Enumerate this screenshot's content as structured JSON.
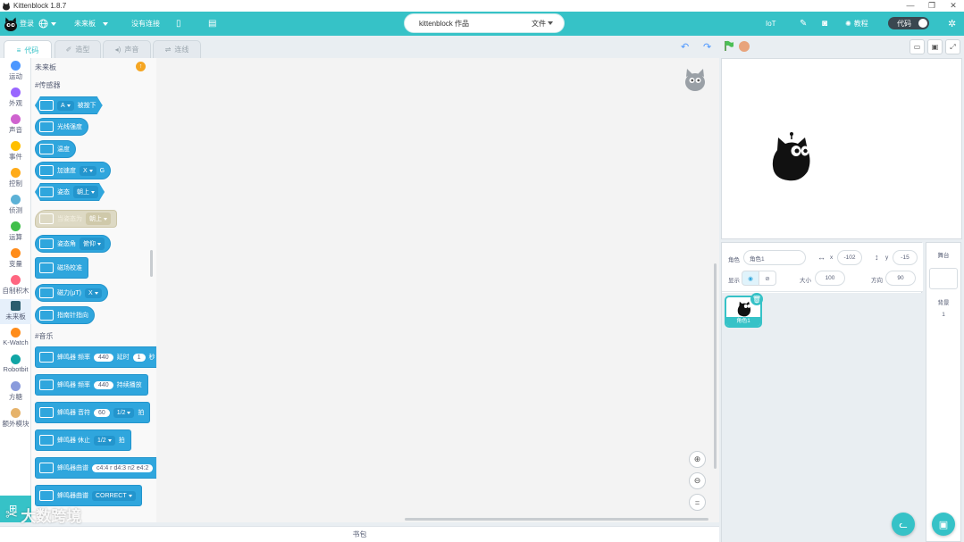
{
  "window": {
    "title": "Kittenblock 1.8.7",
    "controls": [
      "—",
      "❐",
      "✕"
    ]
  },
  "menubar": {
    "login": "登录",
    "board": "未来板",
    "device_status": "没有连接",
    "project_name": "kittenblock 作品",
    "file_menu": "文件",
    "iot": "IoT",
    "tutorial": "教程",
    "code_toggle": "代码"
  },
  "tabs": [
    {
      "label": "代码",
      "active": true
    },
    {
      "label": "造型",
      "active": false
    },
    {
      "label": "声音",
      "active": false
    },
    {
      "label": "连线",
      "active": false
    }
  ],
  "categories": [
    {
      "label": "运动",
      "color": "#4c97ff"
    },
    {
      "label": "外观",
      "color": "#9966ff"
    },
    {
      "label": "声音",
      "color": "#cf63cf"
    },
    {
      "label": "事件",
      "color": "#ffbf00"
    },
    {
      "label": "控制",
      "color": "#ffab19"
    },
    {
      "label": "侦测",
      "color": "#5cb1d6"
    },
    {
      "label": "运算",
      "color": "#40bf4a"
    },
    {
      "label": "变量",
      "color": "#ff8c1a"
    },
    {
      "label": "自制积木",
      "color": "#ff6680"
    },
    {
      "label": "未来板",
      "color": "#2b5d6e"
    },
    {
      "label": "K-Watch",
      "color": "#ff8c1a"
    },
    {
      "label": "Robotbit",
      "color": "#11a5a5"
    },
    {
      "label": "方糖",
      "color": "#8a9bdc"
    },
    {
      "label": "额外模块",
      "color": "#e6b36b"
    }
  ],
  "palette": {
    "title": "未来板",
    "section_sensors": "#传感器",
    "section_music": "#音乐",
    "blocks": {
      "button_pressed": {
        "dropdown": "A",
        "text": "被按下"
      },
      "light": "光线强度",
      "temperature": "温度",
      "accel": {
        "text": "加速度",
        "dropdown": "X",
        "suffix": "G"
      },
      "posture": {
        "text": "姿态",
        "dropdown": "朝上"
      },
      "when_posture": {
        "text": "当姿态为",
        "dropdown": "朝上"
      },
      "posture_angle": {
        "text": "姿态角",
        "dropdown": "俯仰"
      },
      "mag_calibrate": "磁场校准",
      "magnetic": {
        "text": "磁力(μT)",
        "dropdown": "X"
      },
      "compass": "指南针指向",
      "buzzer_freq_delay": {
        "text": "蜂鸣器 频率",
        "freq": "440",
        "mid": "延时",
        "delay": "1",
        "unit": "秒"
      },
      "buzzer_freq_hold": {
        "text": "蜂鸣器 频率",
        "freq": "440",
        "suffix": "持续播放"
      },
      "buzzer_note": {
        "text": "蜂鸣器 音符",
        "note": "60",
        "beat": "1/2",
        "suffix": "拍"
      },
      "buzzer_rest": {
        "text": "蜂鸣器 休止",
        "beat": "1/2",
        "suffix": "拍"
      },
      "buzzer_melody": {
        "text": "蜂鸣器曲谱",
        "value": "c4:4 r d4:3 n2 e4:2"
      },
      "buzzer_tune": {
        "text": "蜂鸣器曲谱",
        "dropdown": "CORRECT"
      }
    }
  },
  "bookbag": "书包",
  "sprite_info": {
    "sprite_label": "角色",
    "sprite_name": "角色1",
    "x_label": "x",
    "x_value": "-102",
    "y_label": "y",
    "y_value": "-15",
    "show_label": "显示",
    "size_label": "大小",
    "size_value": "100",
    "direction_label": "方向",
    "direction_value": "90"
  },
  "sprites": [
    {
      "name": "角色1",
      "selected": true
    }
  ],
  "stage_panel": {
    "title": "舞台",
    "backdrops_label": "背景",
    "backdrops_count": "1"
  },
  "watermark": "大数跨境"
}
